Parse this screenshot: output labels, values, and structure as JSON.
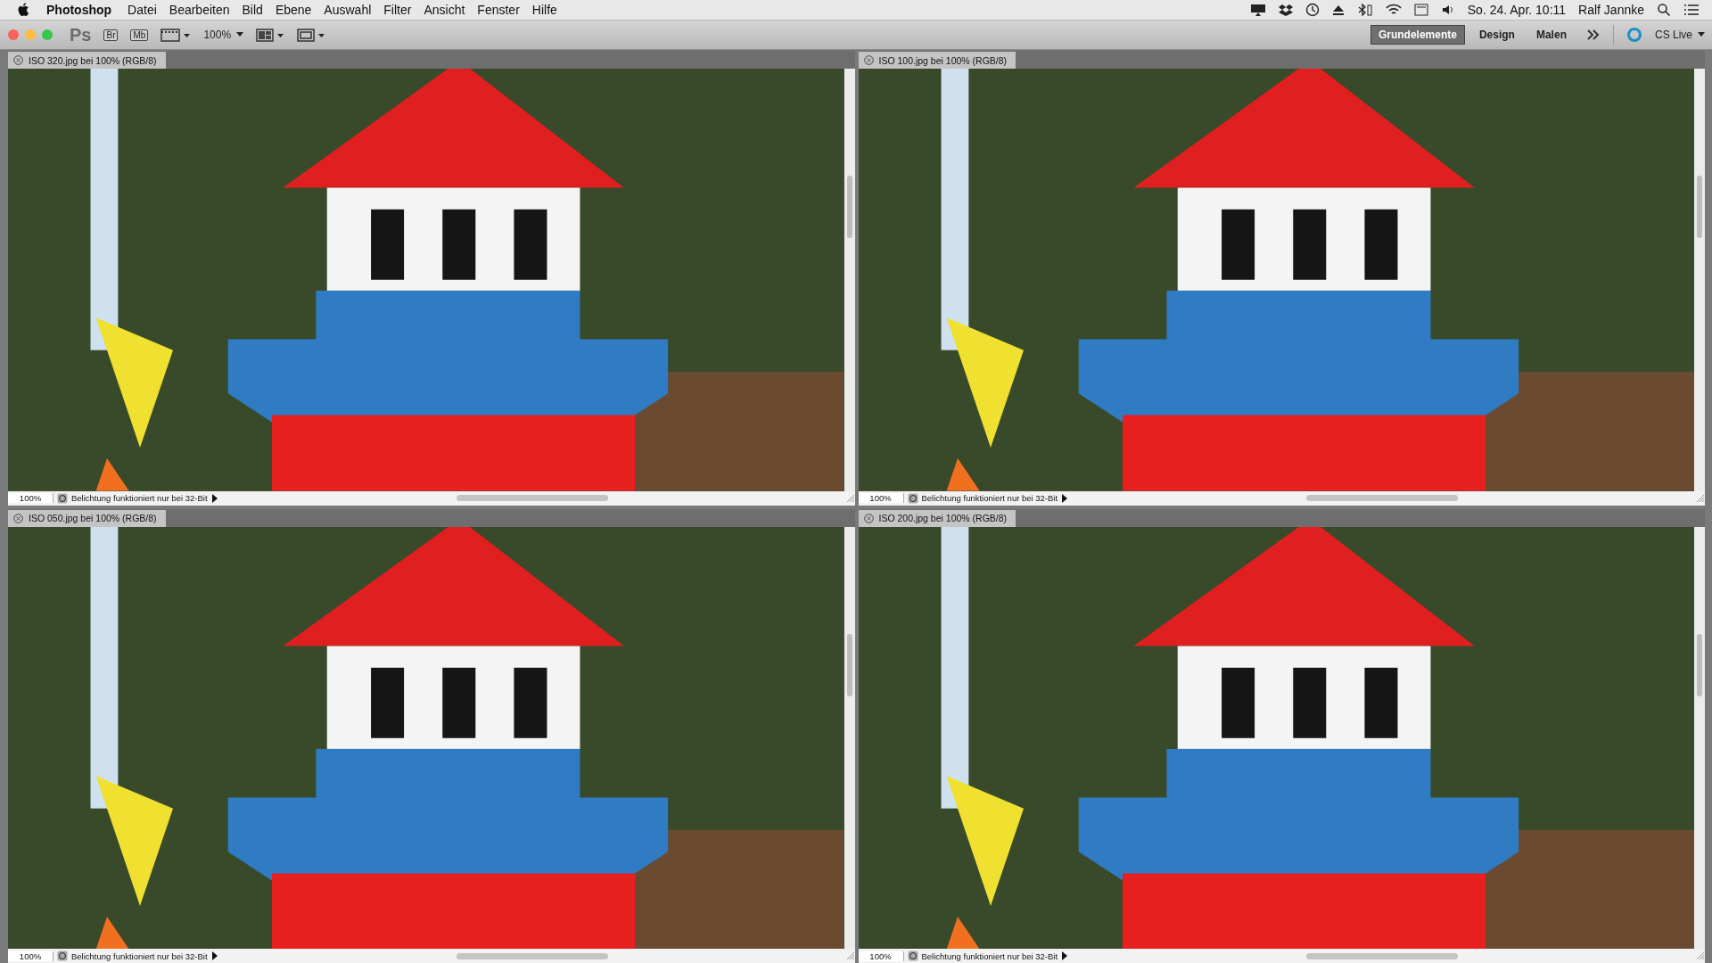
{
  "menu_bar": {
    "app_name": "Photoshop",
    "menus": [
      "Datei",
      "Bearbeiten",
      "Bild",
      "Ebene",
      "Auswahl",
      "Filter",
      "Ansicht",
      "Fenster",
      "Hilfe"
    ],
    "clock": "So. 24. Apr. 10:11",
    "user": "Ralf Jannke"
  },
  "toolbar": {
    "app_logo": "Ps",
    "bridge": "Br",
    "mini_bridge": "Mb",
    "zoom": "100%",
    "workspaces": [
      {
        "label": "Grundelemente",
        "selected": true
      },
      {
        "label": "Design",
        "selected": false
      },
      {
        "label": "Malen",
        "selected": false
      }
    ],
    "cs_live": "CS Live"
  },
  "documents": [
    {
      "title": "ISO 320.jpg bei 100% (RGB/8)",
      "zoom": "100%",
      "status": "Belichtung funktioniert nur bei 32-Bit"
    },
    {
      "title": "ISO 100.jpg bei 100% (RGB/8)",
      "zoom": "100%",
      "status": "Belichtung funktioniert nur bei 32-Bit"
    },
    {
      "title": "ISO 050.jpg bei 100% (RGB/8)",
      "zoom": "100%",
      "status": "Belichtung funktioniert nur bei 32-Bit"
    },
    {
      "title": "ISO 200.jpg bei 100% (RGB/8)",
      "zoom": "100%",
      "status": "Belichtung funktioniert nur bei 32-Bit"
    }
  ]
}
